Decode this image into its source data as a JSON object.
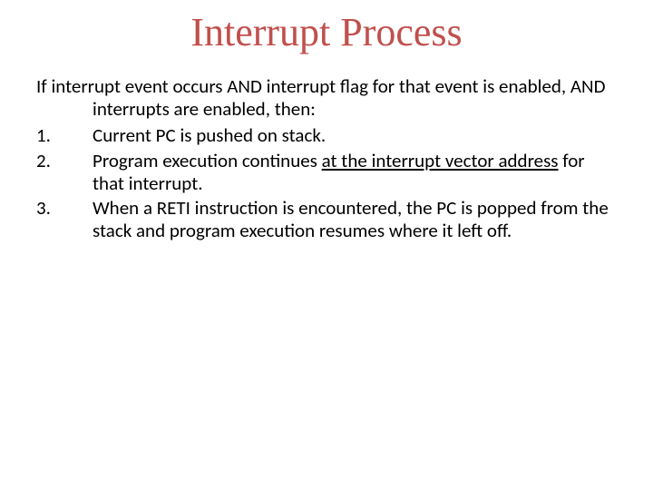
{
  "title": "Interrupt Process",
  "intro_prefix": "If interrupt event occurs AND interrupt flag for that event is",
  "intro_rest": "enabled, AND interrupts are enabled, then:",
  "items": [
    {
      "num": "1.",
      "text": "Current PC is pushed on stack."
    },
    {
      "num": "2.",
      "text_before": "Program execution continues ",
      "underlined": "at the interrupt vector address",
      "text_after": " for that interrupt."
    },
    {
      "num": "3.",
      "text": "When a RETI instruction is encountered, the PC is popped from the stack and program execution resumes where it left off."
    }
  ]
}
